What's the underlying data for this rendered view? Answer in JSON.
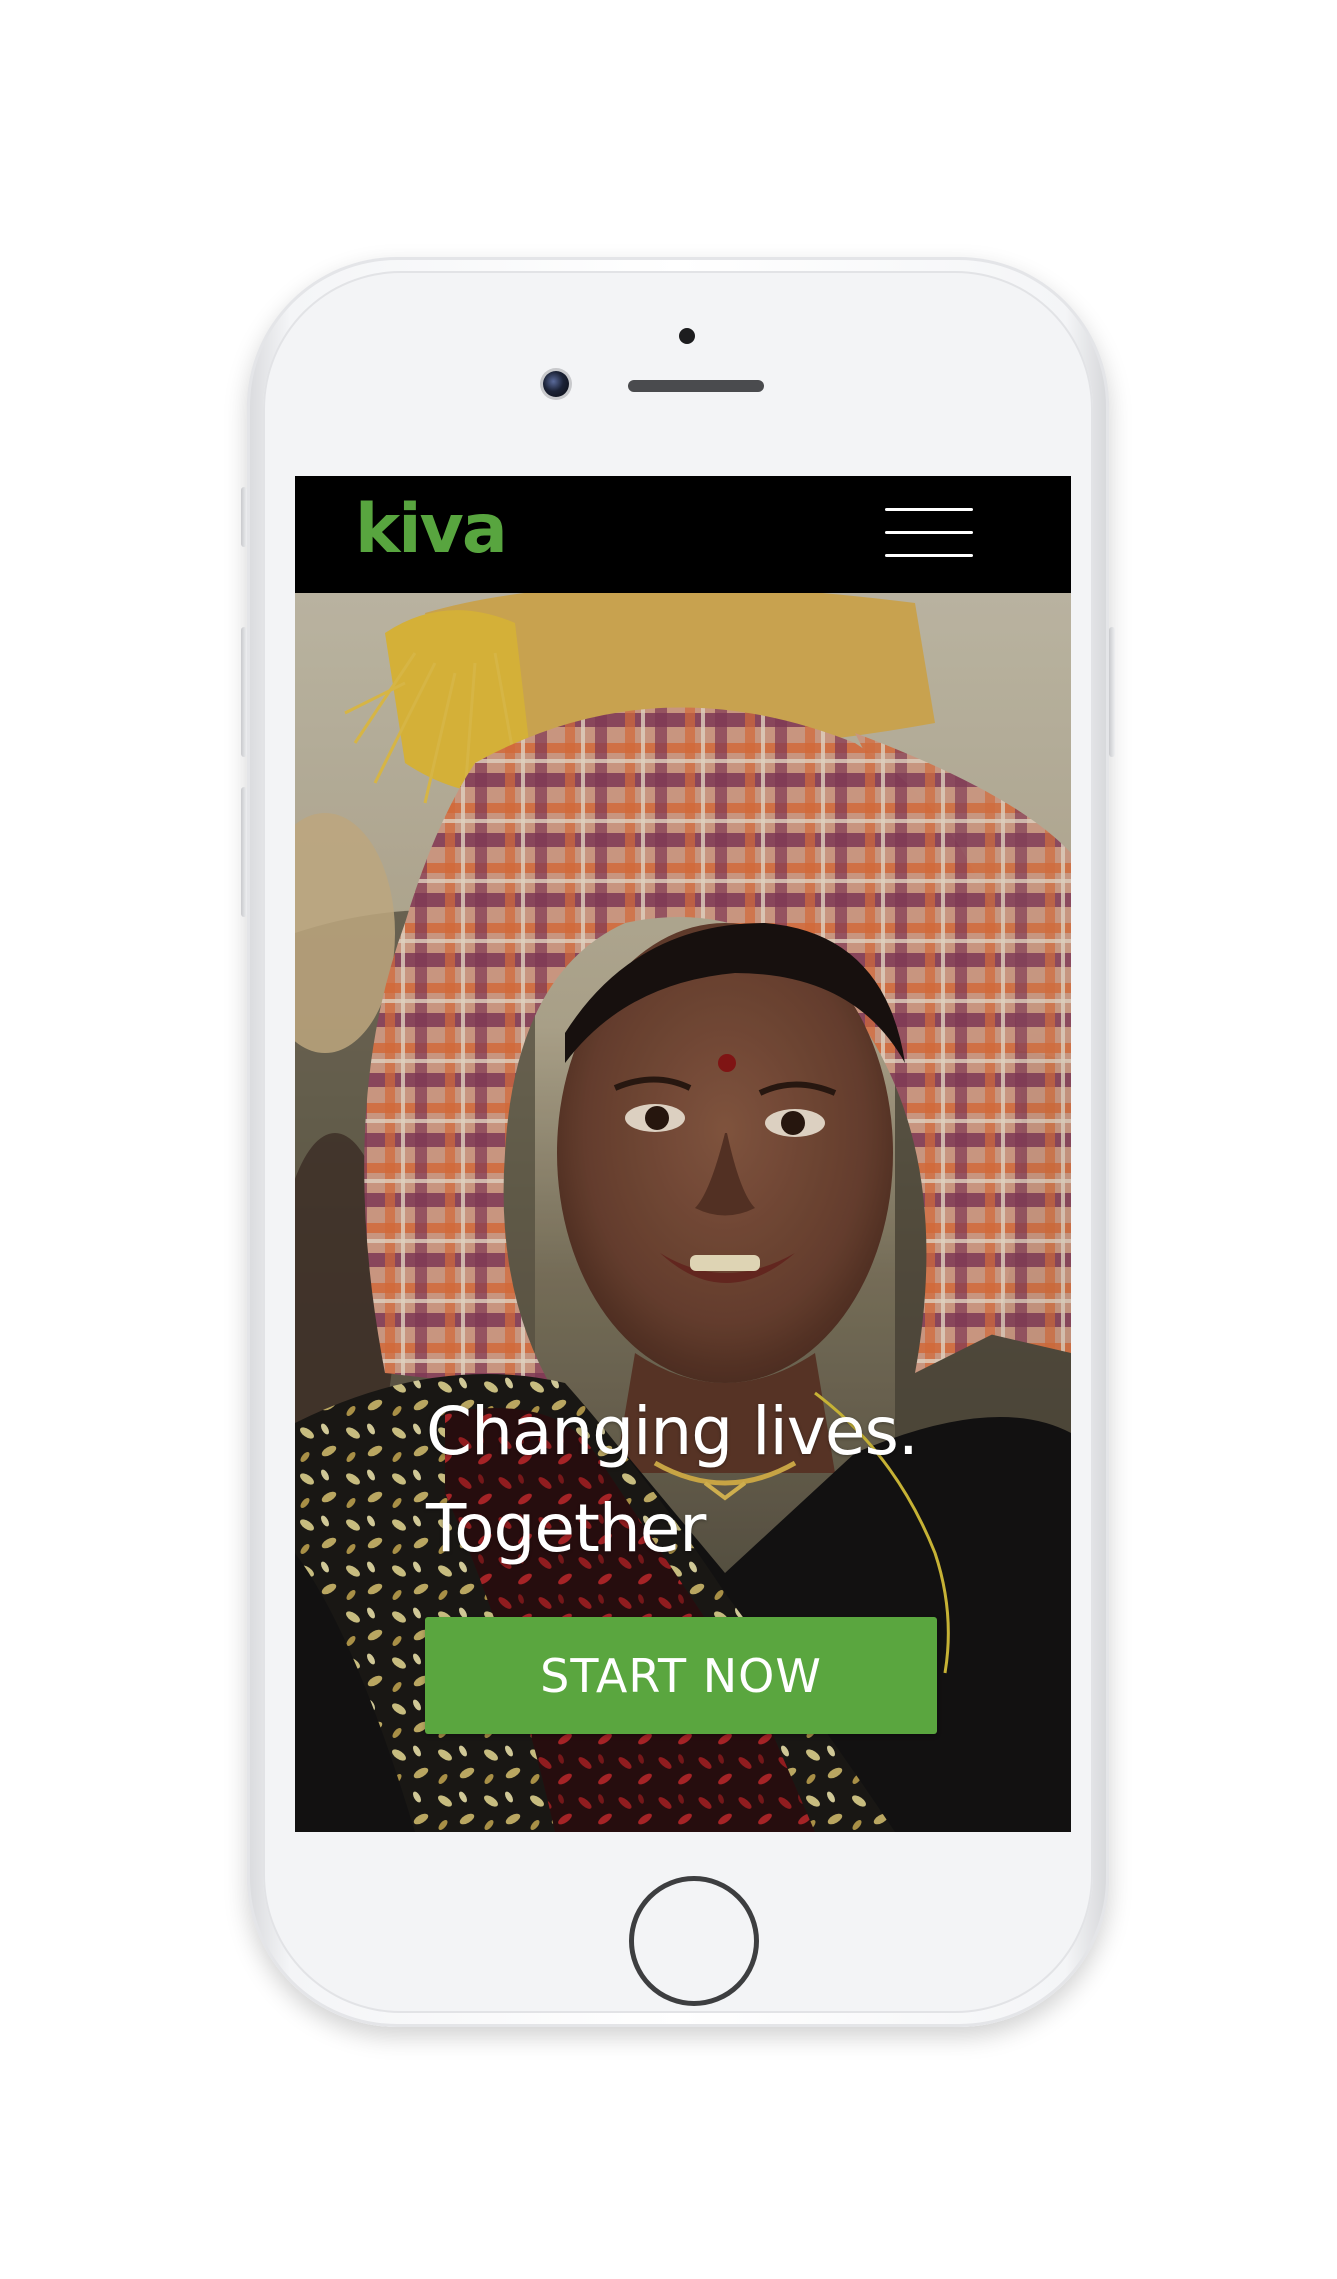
{
  "navbar": {
    "logo_text": "kiva",
    "menu_icon": "hamburger-menu-icon"
  },
  "hero": {
    "headline_line1": "Changing lives.",
    "headline_line2": "Together",
    "cta_label": "START NOW",
    "image": "portrait-woman-headscarf-photo"
  },
  "colors": {
    "brand_green": "#5aa63f",
    "navbar_bg": "#000000",
    "headline_text": "#ffffff"
  },
  "device": {
    "frame": "iphone-white"
  }
}
